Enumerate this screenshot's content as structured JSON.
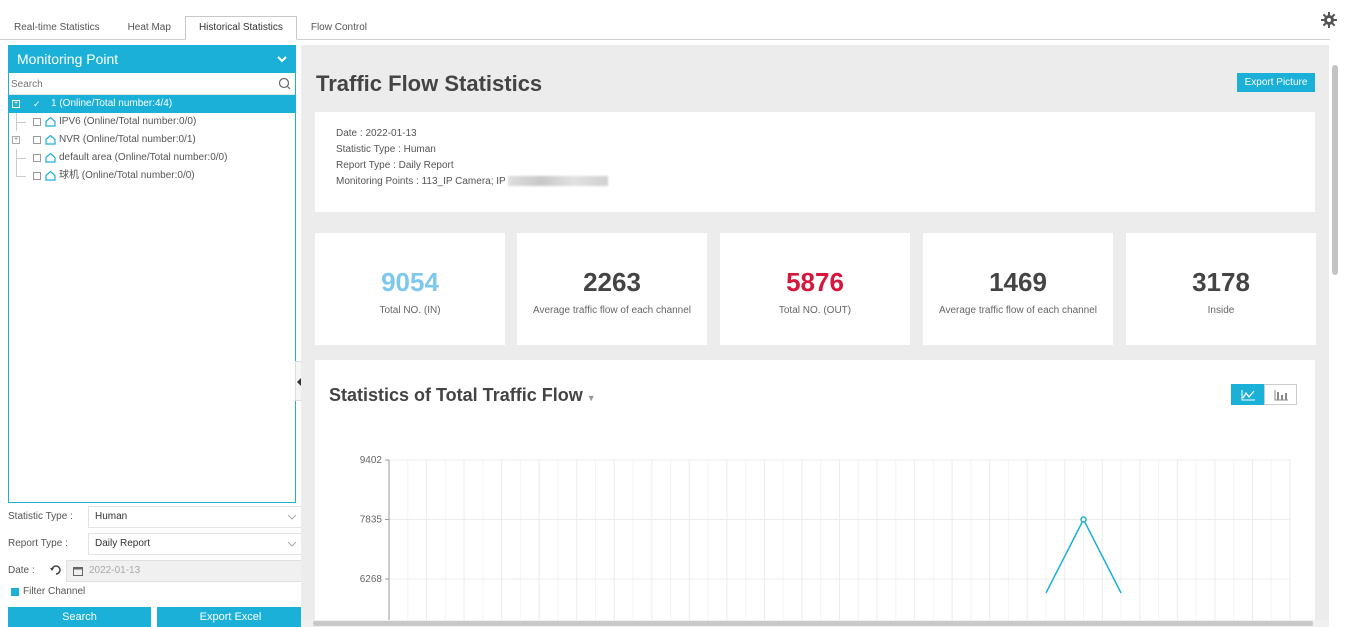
{
  "tabs": [
    "Real-time Statistics",
    "Heat Map",
    "Historical Statistics",
    "Flow Control"
  ],
  "active_tab": "Historical Statistics",
  "sidebar": {
    "header": "Monitoring Point",
    "search_placeholder": "Search",
    "tree": [
      {
        "label": "1 (Online/Total number:4/4)",
        "selected": true,
        "expandable": true
      },
      {
        "label": "IPV6 (Online/Total number:0/0)",
        "selected": false,
        "expandable": false
      },
      {
        "label": "NVR (Online/Total number:0/1)",
        "selected": false,
        "expandable": true
      },
      {
        "label": "default area (Online/Total number:0/0)",
        "selected": false,
        "expandable": false
      },
      {
        "label": "球机 (Online/Total number:0/0)",
        "selected": false,
        "expandable": false
      }
    ],
    "statistic_type_label": "Statistic Type :",
    "statistic_type_value": "Human",
    "report_type_label": "Report Type :",
    "report_type_value": "Daily Report",
    "date_label": "Date :",
    "date_value": "2022-01-13",
    "filter_label": "Filter Channel",
    "search_button": "Search",
    "export_excel_button": "Export Excel"
  },
  "main": {
    "title": "Traffic Flow Statistics",
    "export_picture": "Export Picture",
    "info": {
      "date": "Date : 2022-01-13",
      "statistic_type": "Statistic Type : Human",
      "report_type": "Report Type : Daily Report",
      "monitoring_points": "Monitoring Points : 113_IP Camera; IP"
    },
    "stats": [
      {
        "value": "9054",
        "label": "Total NO. (IN)",
        "color": "#7ec8ef"
      },
      {
        "value": "2263",
        "label": "Average traffic flow of each channel",
        "color": "#444444"
      },
      {
        "value": "5876",
        "label": "Total NO. (OUT)",
        "color": "#d4173a"
      },
      {
        "value": "1469",
        "label": "Average traffic flow of each channel",
        "color": "#444444"
      },
      {
        "value": "3178",
        "label": "Inside",
        "color": "#444444"
      }
    ],
    "chart_title": "Statistics of Total Traffic Flow"
  },
  "chart_data": {
    "type": "line",
    "y_ticks": [
      9402,
      7835,
      6268
    ],
    "ylim_visible": [
      6000,
      9402
    ],
    "x_count": 24,
    "series": [
      {
        "values": [
          null,
          null,
          null,
          null,
          null,
          null,
          null,
          null,
          null,
          null,
          null,
          null,
          null,
          null,
          null,
          null,
          null,
          5900,
          7835,
          5900,
          null,
          null,
          null,
          null
        ]
      }
    ],
    "line_color": "#1ab0d8"
  },
  "colors": {
    "accent": "#1ab0d8",
    "background": "#ececec"
  }
}
